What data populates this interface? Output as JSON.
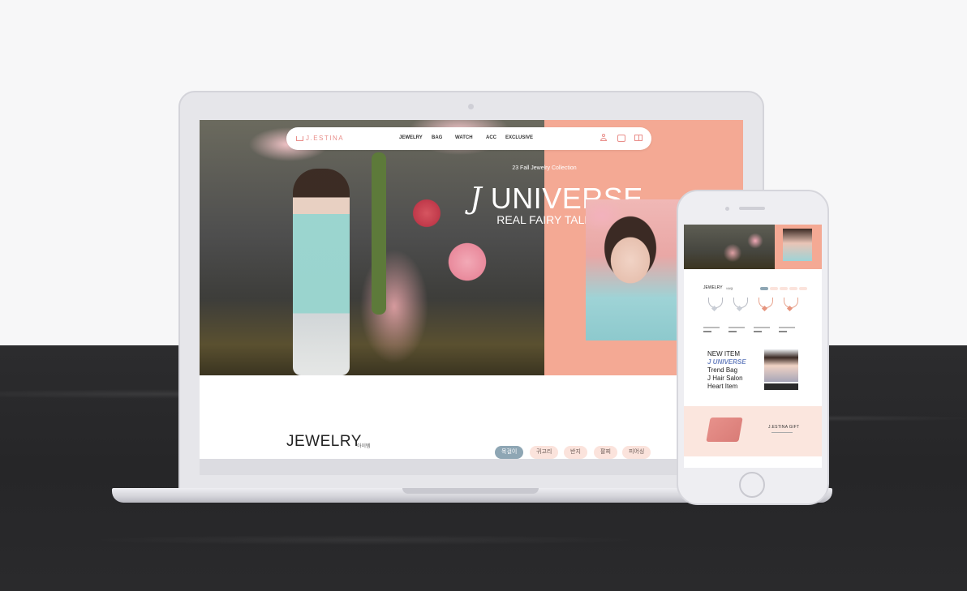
{
  "site": {
    "logo_text": "J.ESTINA",
    "nav": [
      "JEWELRY",
      "BAG",
      "WATCH",
      "ACC",
      "EXCLUSIVE"
    ],
    "nav_icons": [
      "user-icon",
      "shopping-bag-icon",
      "gift-icon"
    ]
  },
  "hero": {
    "collection": "23 Fall Jewelry Collection",
    "title_mark": "J",
    "title_rest": " UNIVERSE",
    "subtitle": "REAL FAIRY TALE"
  },
  "jewelry": {
    "title": "JEWELRY",
    "subtitle": "아이템",
    "tabs": [
      "목걸이",
      "귀고리",
      "반지",
      "팔찌",
      "피어싱"
    ],
    "active_tab": "목걸이"
  },
  "mobile": {
    "new_item": "NEW ITEM",
    "universe": "J UNIVERSE",
    "trend_bag": "Trend Bag",
    "hair_salon": "J Hair Salon",
    "heart_item": "Heart Item",
    "gift_title": "J.ESTINA GIFT"
  },
  "colors": {
    "accent_pink": "#e98e8a",
    "hero_panel": "#f4a994",
    "active_tab": "#8ea6b4",
    "tab_bg": "#fbe3dc"
  }
}
